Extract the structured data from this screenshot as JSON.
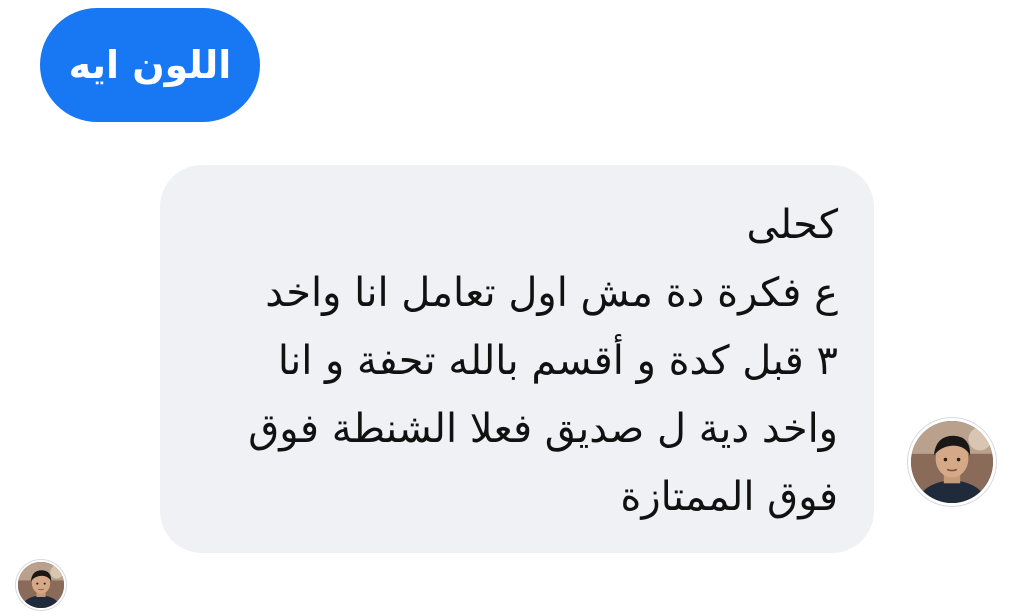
{
  "conversation": {
    "sent_message": {
      "text": "اللون ايه"
    },
    "received_message": {
      "lines": [
        "كحلى",
        "ع فكرة دة مش اول تعامل انا واخد",
        "٣ قبل كدة و أقسم بالله تحفة و انا",
        "واخد دية ل صديق فعلا الشنطة فوق",
        "فوق الممتازة"
      ]
    },
    "avatar_icon": "avatar-icon"
  },
  "colors": {
    "sent_bubble": "#1877f2",
    "received_bubble": "#f0f1f5",
    "text_dark": "#111111",
    "text_light": "#ffffff"
  }
}
